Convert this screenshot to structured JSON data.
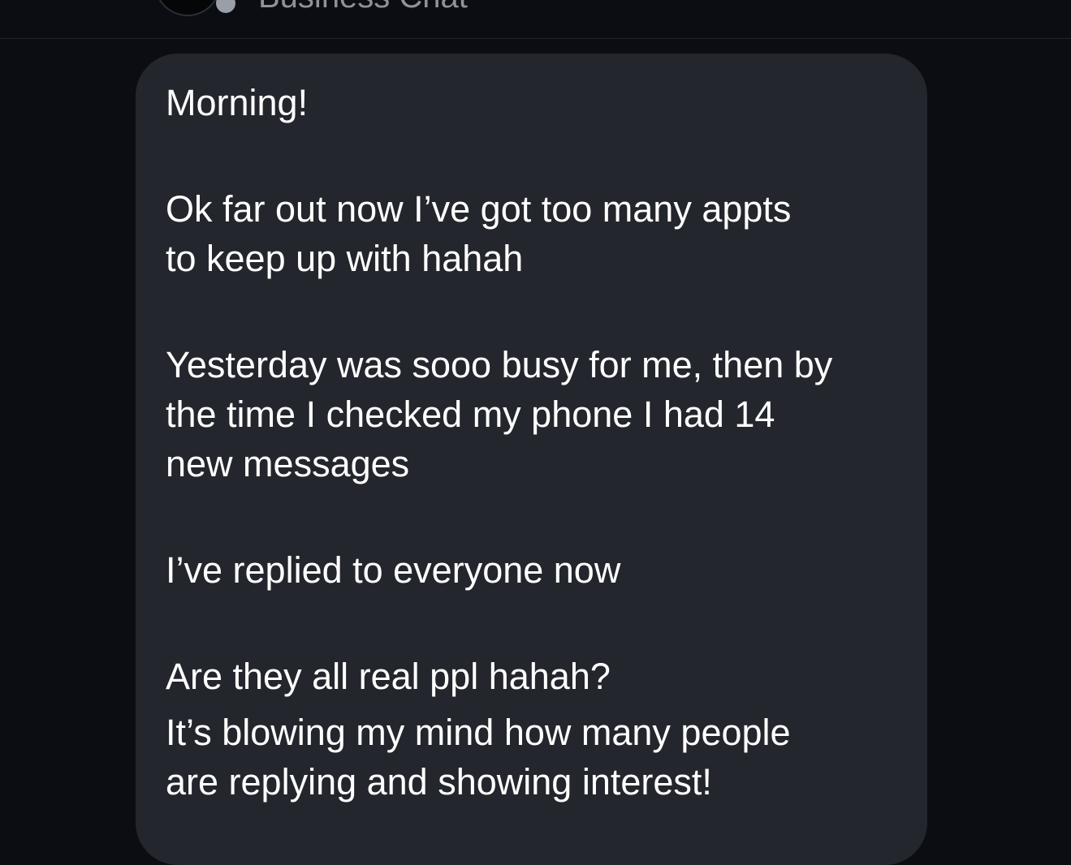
{
  "header": {
    "chat_name": "Business Chat"
  },
  "message": {
    "paragraphs": [
      "Morning!",
      "Ok far out now I’ve got too many appts\nto keep up with hahah",
      "Yesterday was sooo busy for me, then by\nthe time I checked my phone I had 14\nnew messages",
      "I’ve replied to everyone now",
      "Are they all real ppl hahah?",
      "It’s blowing my mind how many people\nare replying and showing interest!"
    ]
  },
  "colors": {
    "background": "#0b0d12",
    "bubble": "#24262d",
    "text": "#ffffff",
    "header_text": "#8e929a"
  }
}
